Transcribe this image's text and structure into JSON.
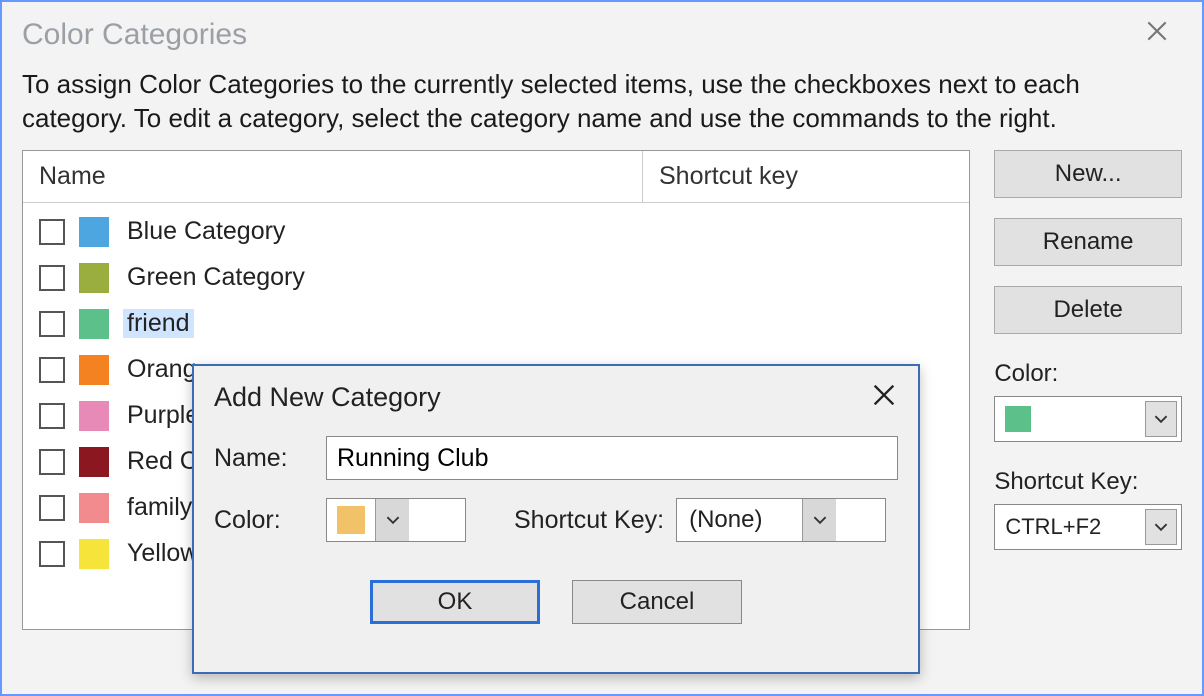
{
  "window": {
    "title": "Color Categories",
    "instructions": "To assign Color Categories to the currently selected items, use the checkboxes next to each category.  To edit a category, select the category name and use the commands to the right."
  },
  "list": {
    "header_name": "Name",
    "header_shortcut": "Shortcut key",
    "items": [
      {
        "label": "Blue Category",
        "color": "#4da6e0",
        "selected": false
      },
      {
        "label": "Green Category",
        "color": "#9aae3f",
        "selected": false
      },
      {
        "label": "friend",
        "color": "#5cc08a",
        "selected": true
      },
      {
        "label": "Orang",
        "color": "#f58220",
        "selected": false
      },
      {
        "label": "Purple",
        "color": "#e88ab8",
        "selected": false
      },
      {
        "label": "Red C",
        "color": "#8b1820",
        "selected": false
      },
      {
        "label": "family",
        "color": "#f28b8d",
        "selected": false
      },
      {
        "label": "Yellow",
        "color": "#f7e43a",
        "selected": false
      }
    ]
  },
  "sidebar": {
    "new_label": "New...",
    "rename_label": "Rename",
    "delete_label": "Delete",
    "color_label": "Color:",
    "color_swatch": "#5cc08a",
    "shortcut_label": "Shortcut Key:",
    "shortcut_value": "CTRL+F2"
  },
  "modal": {
    "title": "Add New Category",
    "name_label": "Name:",
    "name_value": "Running Club",
    "color_label": "Color:",
    "color_swatch": "#f2c268",
    "shortcut_label": "Shortcut Key:",
    "shortcut_value": "(None)",
    "ok_label": "OK",
    "cancel_label": "Cancel"
  }
}
